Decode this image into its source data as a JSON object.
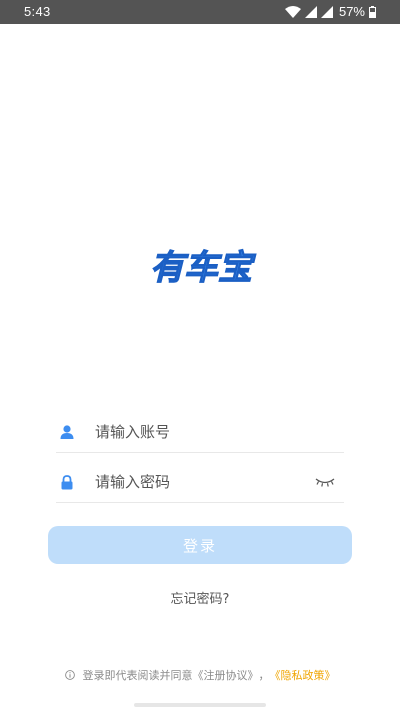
{
  "status_bar": {
    "time": "5:43",
    "battery": "57%"
  },
  "logo": {
    "text": "有车宝",
    "color": "#3d8df0"
  },
  "login_form": {
    "account_placeholder": "请输入账号",
    "password_placeholder": "请输入密码",
    "login_label": "登录",
    "forgot_label": "忘记密码?"
  },
  "agreement": {
    "prefix": "登录即代表阅读并同意",
    "terms_link": "《注册协议》",
    "separator": "，",
    "privacy_link": "《隐私政策》"
  },
  "colors": {
    "accent": "#3d8df0",
    "button_bg": "#bfddfa",
    "privacy_link": "#f0a500"
  }
}
